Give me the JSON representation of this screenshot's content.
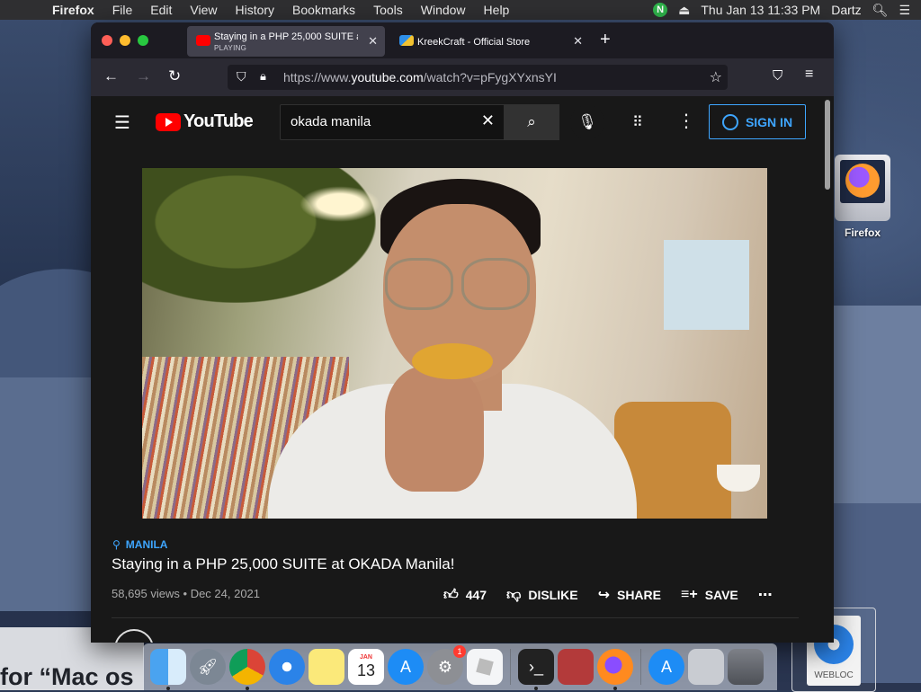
{
  "menubar": {
    "app": "Firefox",
    "items": [
      "File",
      "Edit",
      "View",
      "History",
      "Bookmarks",
      "Tools",
      "Window",
      "Help"
    ],
    "clock": "Thu Jan 13  11:33 PM",
    "user": "Dartz",
    "norton_badge": "N"
  },
  "desktop": {
    "icon_label": "Firefox",
    "webloc_label": "WEBLOC",
    "bottom_text": "for “Mac os"
  },
  "browser": {
    "tabs": [
      {
        "title": "Staying in a PHP 25,000 SUITE a",
        "subtitle": "PLAYING",
        "active": true
      },
      {
        "title": "KreekCraft - Official Store",
        "active": false
      }
    ],
    "url_prefix": "https://www.",
    "url_domain": "youtube.com",
    "url_path": "/watch?v=pFygXYxnsYI"
  },
  "youtube": {
    "logo_text": "YouTube",
    "search_value": "okada manila",
    "sign_in_label": "SIGN IN",
    "video": {
      "location": "MANILA",
      "title": "Staying in a PHP 25,000 SUITE at OKADA Manila!",
      "views": "58,695 views",
      "date": "Dec 24, 2021",
      "likes": "447",
      "dislike_label": "DISLIKE",
      "share_label": "SHARE",
      "save_label": "SAVE"
    }
  },
  "dock": {
    "calendar_month": "JAN",
    "calendar_day": "13",
    "settings_badge": "1"
  },
  "colors": {
    "youtube_red": "#ff0000",
    "link_blue": "#3ea6ff",
    "yt_background": "#181818",
    "firefox_toolbar": "#2b2a33"
  }
}
